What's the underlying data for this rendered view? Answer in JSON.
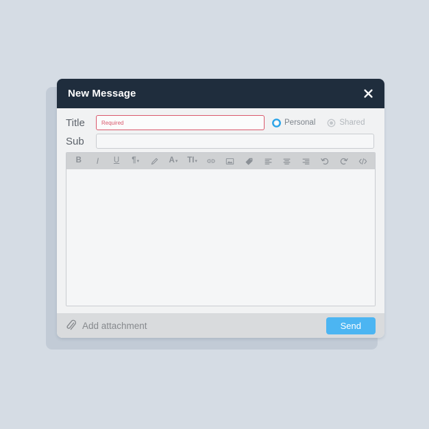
{
  "window": {
    "title": "New Message",
    "close_icon": "close-icon"
  },
  "form": {
    "title_label": "Title",
    "title_value": "",
    "title_placeholder": "Required",
    "title_required": true,
    "sub_label": "Sub",
    "sub_value": "",
    "sub_placeholder": "",
    "visibility": {
      "selected": "Personal",
      "options": [
        {
          "label": "Personal",
          "selected": true
        },
        {
          "label": "Shared",
          "selected": false
        }
      ]
    }
  },
  "editor": {
    "content": "",
    "toolbar": [
      {
        "name": "bold-icon",
        "label": "B"
      },
      {
        "name": "italic-icon",
        "label": "I"
      },
      {
        "name": "underline-icon",
        "label": "U"
      },
      {
        "name": "paragraph-icon",
        "label": "¶"
      },
      {
        "name": "pencil-icon",
        "label": ""
      },
      {
        "name": "font-color-icon",
        "label": "A"
      },
      {
        "name": "text-size-icon",
        "label": "TI"
      },
      {
        "name": "link-icon",
        "label": ""
      },
      {
        "name": "image-icon",
        "label": ""
      },
      {
        "name": "tag-icon",
        "label": ""
      },
      {
        "name": "align-left-icon",
        "label": ""
      },
      {
        "name": "align-center-icon",
        "label": ""
      },
      {
        "name": "align-right-icon",
        "label": ""
      },
      {
        "name": "undo-icon",
        "label": ""
      },
      {
        "name": "redo-icon",
        "label": ""
      },
      {
        "name": "code-icon",
        "label": "</>"
      }
    ]
  },
  "footer": {
    "attachment_label": "Add attachment",
    "attachment_icon": "paperclip-icon",
    "send_label": "Send"
  },
  "colors": {
    "page_background": "#d5dce4",
    "titlebar": "#1f2d3d",
    "dialog_background": "#f1f2f3",
    "toolbar": "#cfd1d3",
    "footer": "#d9dbdd",
    "accent_blue": "#4cb5f2",
    "radio_selected": "#29a3e8",
    "error_red": "#d9566a",
    "shadow_panel": "#c2cbd6"
  }
}
